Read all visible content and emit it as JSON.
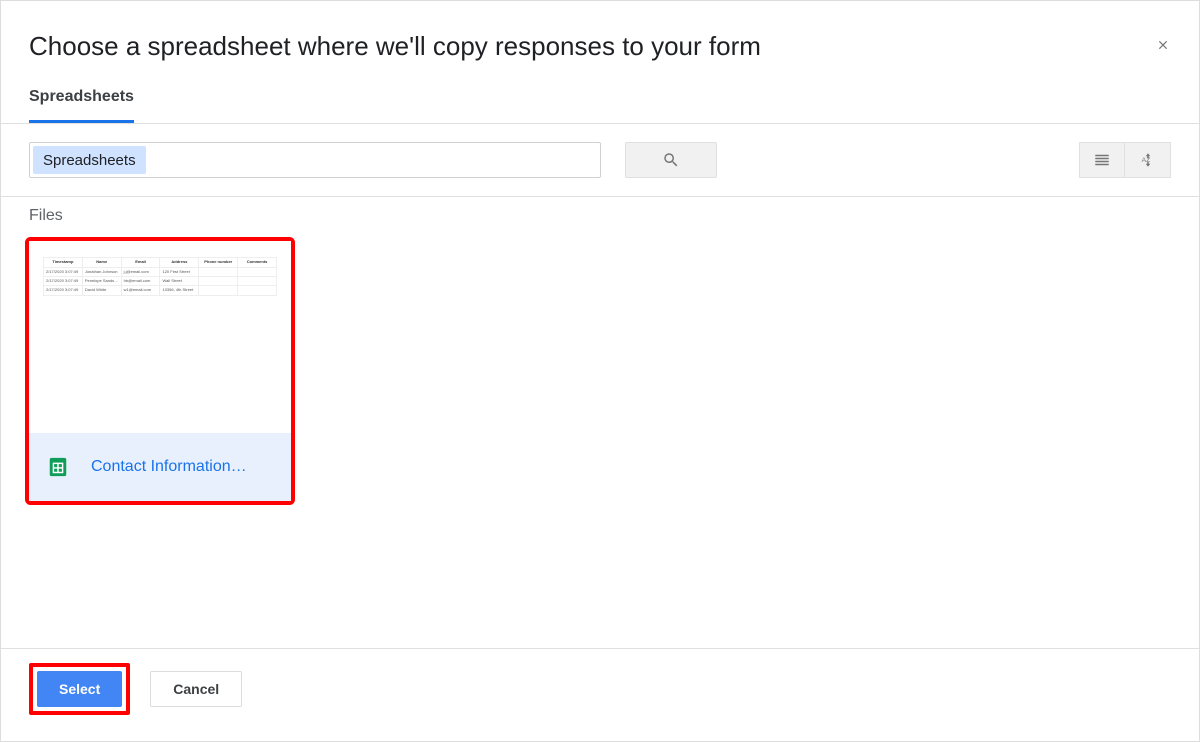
{
  "header": {
    "title": "Choose a spreadsheet where we'll copy responses to your form"
  },
  "tabs": {
    "active_label": "Spreadsheets"
  },
  "toolbar": {
    "chip_text": "Spreadsheets",
    "search_placeholder": "",
    "search_value": ""
  },
  "content": {
    "section_label": "Files",
    "selected_file_name": "Contact Information…",
    "thumb_headers": [
      "Timestamp",
      "Name",
      "Email",
      "Address",
      "Phone number",
      "Comments"
    ],
    "thumb_rows": [
      [
        "2/17/2020 3:07:49",
        "Jonathan Johnson",
        "j.j@email.com",
        "120 First Street",
        "",
        ""
      ],
      [
        "2/17/2020 3:07:49",
        "Penelope Sands-Hackington",
        "hb@email.com",
        "Wall Street",
        "",
        ""
      ],
      [
        "2/17/2020 3:07:49",
        "David White",
        "w1@email.com",
        "10356, 4th Street",
        "",
        ""
      ]
    ]
  },
  "footer": {
    "select_label": "Select",
    "cancel_label": "Cancel"
  }
}
